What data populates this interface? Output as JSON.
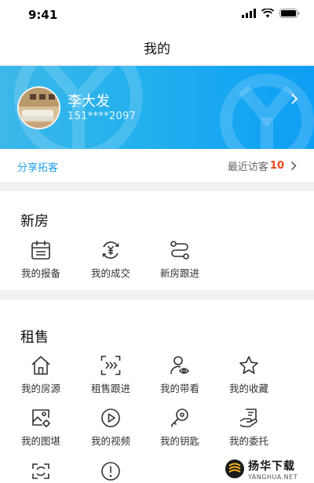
{
  "status_bar": {
    "time": "9:41"
  },
  "nav": {
    "title": "我的"
  },
  "profile": {
    "name": "李大发",
    "phone": "151****2097"
  },
  "share": {
    "label": "分享拓客",
    "visitors_label": "最近访客",
    "visitors_count": "10"
  },
  "new_house": {
    "title": "新房",
    "items": [
      {
        "label": "我的报备",
        "icon": "calendar-icon"
      },
      {
        "label": "我的成交",
        "icon": "yuan-cycle-icon"
      },
      {
        "label": "新房跟进",
        "icon": "route-icon"
      }
    ]
  },
  "rent_sale": {
    "title": "租售",
    "items": [
      {
        "label": "我的房源",
        "icon": "home-icon"
      },
      {
        "label": "租售跟进",
        "icon": "scan-arrows-icon"
      },
      {
        "label": "我的带看",
        "icon": "user-view-icon"
      },
      {
        "label": "我的收藏",
        "icon": "star-icon"
      },
      {
        "label": "我的图堪",
        "icon": "image-settings-icon"
      },
      {
        "label": "我的视频",
        "icon": "play-icon"
      },
      {
        "label": "我的钥匙",
        "icon": "key-icon"
      },
      {
        "label": "我的委托",
        "icon": "hand-doc-icon"
      },
      {
        "label": "",
        "icon": "exchange-icon"
      },
      {
        "label": "",
        "icon": "alert-icon"
      }
    ]
  },
  "watermark": {
    "main": "扬华下载",
    "sub": "YANGHUA.NET"
  },
  "colors": {
    "accent": "#1f9fe8",
    "banner": "#22b0ee",
    "highlight": "#e8491d"
  }
}
